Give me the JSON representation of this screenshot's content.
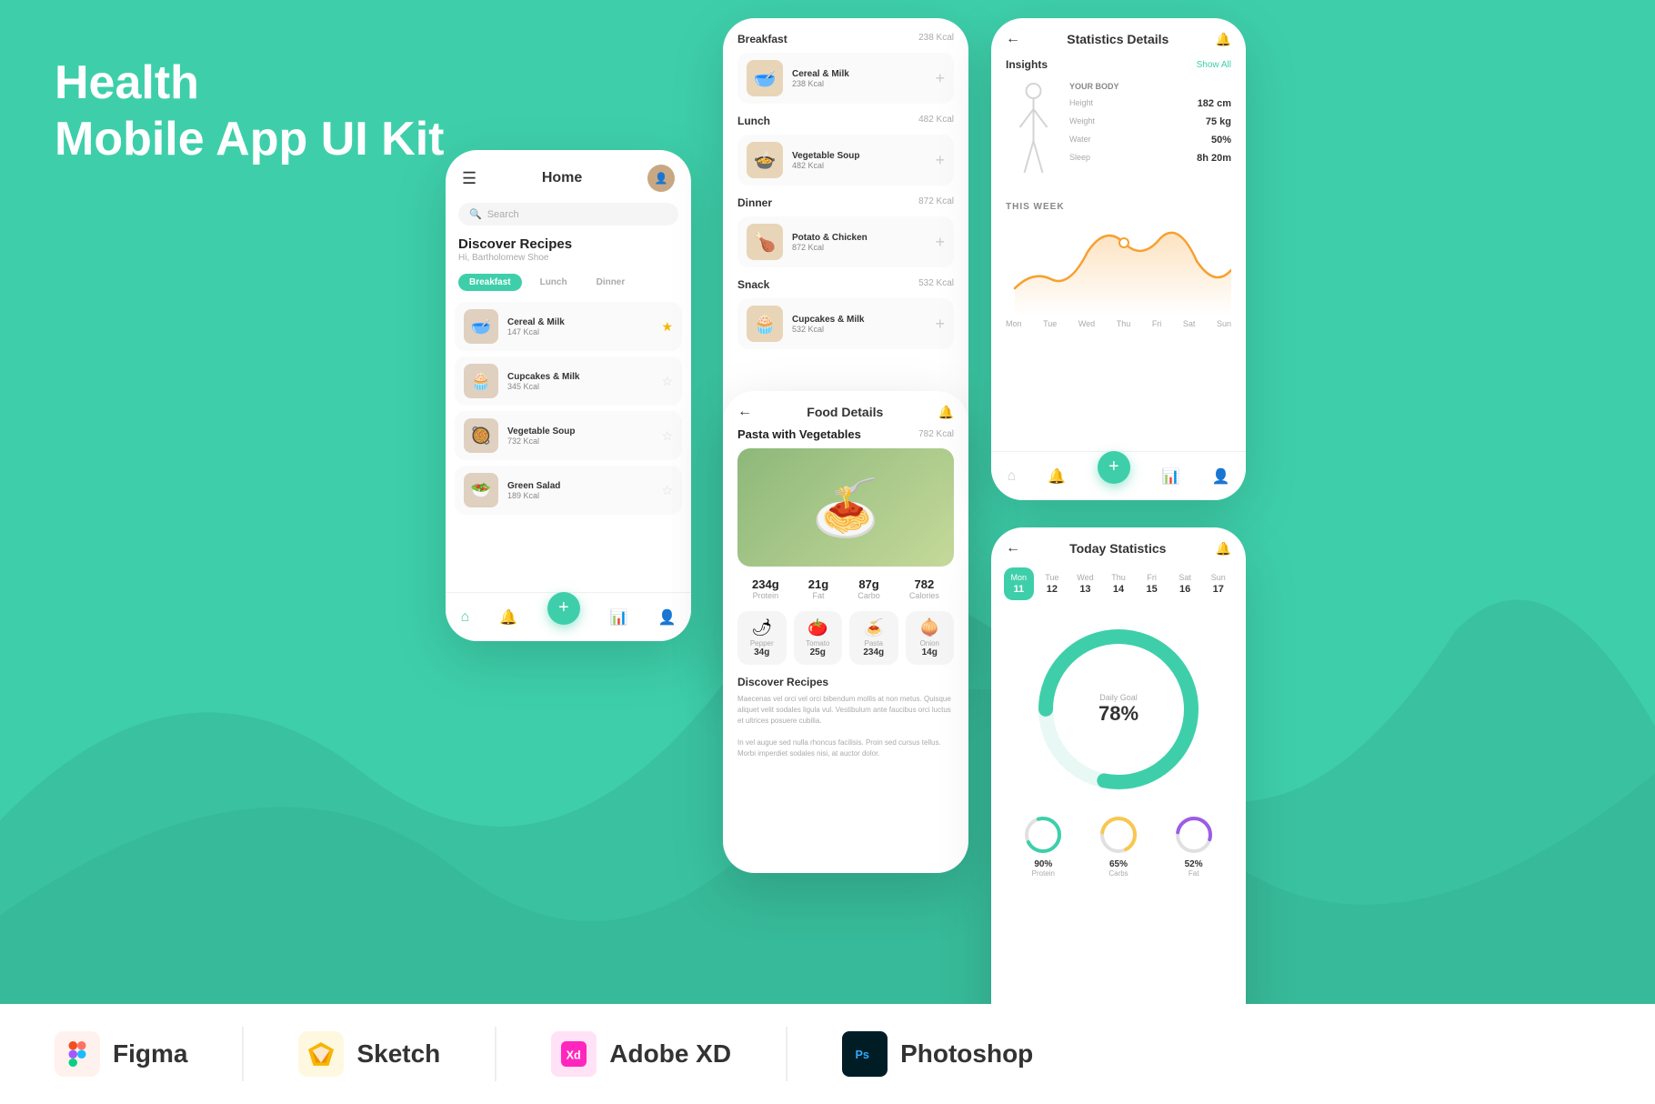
{
  "title": {
    "line1": "Health",
    "line2": "Mobile App UI Kit"
  },
  "tools": [
    {
      "name": "Figma",
      "color": "#f24e1e",
      "icon": "🎨"
    },
    {
      "name": "Sketch",
      "color": "#f7b500",
      "icon": "💎"
    },
    {
      "name": "Adobe XD",
      "color": "#ff26be",
      "icon": "✦"
    },
    {
      "name": "Photoshop",
      "color": "#31a8ff",
      "icon": "Ps"
    }
  ],
  "home_screen": {
    "title": "Home",
    "search_placeholder": "Search",
    "discover_title": "Discover Recipes",
    "discover_sub": "Hi, Bartholomew Shoe",
    "tabs": [
      "Breakfast",
      "Lunch",
      "Dinner"
    ],
    "recipes": [
      {
        "name": "Cereal & Milk",
        "kcal": "147 Kcal",
        "starred": true,
        "emoji": "🥣"
      },
      {
        "name": "Cupcakes & Milk",
        "kcal": "345 Kcal",
        "starred": false,
        "emoji": "🧁"
      },
      {
        "name": "Vegetable Soup",
        "kcal": "732 Kcal",
        "starred": false,
        "emoji": "🥘"
      },
      {
        "name": "Green Salad",
        "kcal": "189 Kcal",
        "starred": false,
        "emoji": "🥗"
      }
    ]
  },
  "meal_log": {
    "sections": [
      {
        "name": "Lunch",
        "kcal": "482 Kcal",
        "items": [
          {
            "name": "Vegetable Soup",
            "kcal": "482 Kcal",
            "emoji": "🍲"
          }
        ]
      },
      {
        "name": "Dinner",
        "kcal": "872 Kcal",
        "items": [
          {
            "name": "Potato & Chicken",
            "kcal": "872 Kcal",
            "emoji": "🍗"
          }
        ]
      },
      {
        "name": "Snack",
        "kcal": "532 Kcal",
        "items": [
          {
            "name": "Cupcakes & Milk",
            "kcal": "532 Kcal",
            "emoji": "🧁"
          }
        ]
      }
    ],
    "breakfast_item": {
      "name": "Cereal & Milk",
      "kcal": "238 Kcal",
      "emoji": "🥣"
    }
  },
  "food_details": {
    "title": "Food Details",
    "food_name": "Pasta with Vegetables",
    "kcal": "782 Kcal",
    "macros": [
      {
        "label": "Protein",
        "value": "234g"
      },
      {
        "label": "Fat",
        "value": "21g"
      },
      {
        "label": "Carbo",
        "value": "87g"
      },
      {
        "label": "Calories",
        "value": "782"
      }
    ],
    "ingredients": [
      {
        "name": "Pepper",
        "amount": "34g",
        "emoji": "🌶"
      },
      {
        "name": "Tomato",
        "amount": "25g",
        "emoji": "🍅"
      },
      {
        "name": "Pasta",
        "amount": "234g",
        "emoji": "🍝"
      },
      {
        "name": "Onion",
        "amount": "14g",
        "emoji": "🧅"
      }
    ],
    "discover_title": "Discover Recipes",
    "discover_text": "Maecenas vel orci vel orci bibendum mollis at non metus. Quisque aliquet velit sodales ligula vul. Vestibulum ante faucibus orci luctus et ultrices posuere cubilia.\n\nIn vel augue sed nulla rhoncus facilisis. Proin sed cursus tellus. Morbi imperdiet sodales nisi, at auctor dolor."
  },
  "statistics": {
    "title": "Statistics Details",
    "insights_label": "Insights",
    "show_all": "Show All",
    "body": {
      "title": "YOUR BODY",
      "metrics": [
        {
          "label": "Height",
          "value": "182 cm"
        },
        {
          "label": "Weight",
          "value": "75 kg"
        },
        {
          "label": "Water",
          "value": "50%"
        },
        {
          "label": "Sleep",
          "value": "8h 20m"
        }
      ]
    },
    "this_week": "THIS WEEK",
    "week_days": [
      "Mon",
      "Tue",
      "Wed",
      "Thu",
      "Fri",
      "Sat",
      "Sun"
    ]
  },
  "today_stats": {
    "title": "Today Statistics",
    "calendar": [
      {
        "day": "Mon",
        "num": "11",
        "active": true
      },
      {
        "day": "Tue",
        "num": "12",
        "active": false
      },
      {
        "day": "Wed",
        "num": "13",
        "active": false
      },
      {
        "day": "Thu",
        "num": "14",
        "active": false
      },
      {
        "day": "Fri",
        "num": "15",
        "active": false
      },
      {
        "day": "Sat",
        "num": "16",
        "active": false
      },
      {
        "day": "Sun",
        "num": "17",
        "active": false
      }
    ],
    "daily_goal_label": "Daily Goal",
    "daily_goal_percent": "78%",
    "stat_items": [
      {
        "label": "Protein",
        "value": "90%",
        "color": "#3ecfaa"
      },
      {
        "label": "Carbs",
        "value": "65%",
        "color": "#f9c74f"
      },
      {
        "label": "Fat",
        "value": "52%",
        "color": "#9b5de5"
      }
    ]
  },
  "accent_color": "#3ecfaa"
}
